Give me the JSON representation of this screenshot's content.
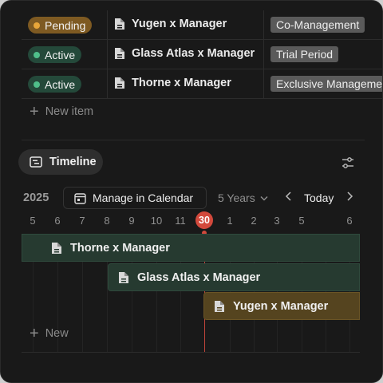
{
  "table": {
    "rows": [
      {
        "status": "Pending",
        "status_type": "pending",
        "name": "Yugen x Manager",
        "tag": "Co-Management"
      },
      {
        "status": "Active",
        "status_type": "active",
        "name": "Glass Atlas x Manager",
        "tag": "Trial Period"
      },
      {
        "status": "Active",
        "status_type": "active",
        "name": "Thorne x Manager",
        "tag": "Exclusive Management"
      }
    ],
    "new_item_label": "New item"
  },
  "timeline": {
    "tab_label": "Timeline",
    "year": "2025",
    "calendar_button": "Manage in Calendar",
    "range": "5 Years",
    "today_button": "Today",
    "days": [
      "5",
      "6",
      "7",
      "8",
      "9",
      "10",
      "11",
      "30",
      "1",
      "2",
      "3",
      "5",
      "6"
    ],
    "today_day": "30",
    "bars": [
      {
        "name": "Thorne x Manager",
        "color": "green"
      },
      {
        "name": "Glass Atlas x Manager",
        "color": "green"
      },
      {
        "name": "Yugen x Manager",
        "color": "amber"
      }
    ],
    "new_label": "New"
  },
  "colors": {
    "background": "#191919",
    "pending": "#7e5a22",
    "active": "#24493a",
    "today_marker": "#d2493c",
    "bar_green": "#263a30",
    "bar_amber": "#55441f"
  }
}
